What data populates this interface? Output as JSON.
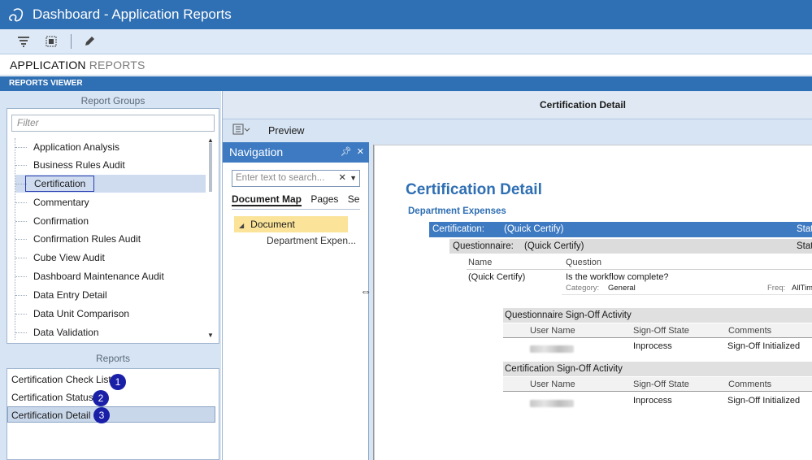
{
  "window": {
    "title": "Dashboard - Application Reports"
  },
  "icons": {
    "logo": "app-logo-icon",
    "filter": "filter-icon",
    "select": "select-icon",
    "edit": "pencil-icon"
  },
  "header": {
    "part1": "APPLICATION",
    "part2": "REPORTS"
  },
  "viewer": {
    "label": "REPORTS VIEWER"
  },
  "report_groups": {
    "heading": "Report Groups",
    "filter_placeholder": "Filter",
    "items": [
      "Application Analysis",
      "Business Rules Audit",
      "Certification",
      "Commentary",
      "Confirmation",
      "Confirmation Rules Audit",
      "Cube View Audit",
      "Dashboard Maintenance Audit",
      "Data Entry Detail",
      "Data Unit Comparison",
      "Data Validation"
    ],
    "selected": "Certification"
  },
  "reports": {
    "heading": "Reports",
    "items": [
      {
        "label": "Certification Check List",
        "badge": "1"
      },
      {
        "label": "Certification Status",
        "badge": "2"
      },
      {
        "label": "Certification Detail",
        "badge": "3"
      }
    ]
  },
  "right": {
    "title": "Certification Detail",
    "preview_label": "Preview"
  },
  "navigation": {
    "heading": "Navigation",
    "search_placeholder": "Enter text to search...",
    "tabs": [
      "Document Map",
      "Pages",
      "Se"
    ],
    "root": "Document",
    "child": "Department Expen..."
  },
  "doc": {
    "title": "Certification Detail",
    "dept": "Department Expenses",
    "cert_label": "Certification:",
    "cert_value": "(Quick Certify)",
    "stat1": "Stat",
    "q_label": "Questionnaire:",
    "q_value": "(Quick Certify)",
    "stat2": "Stat",
    "col_name": "Name",
    "col_question": "Question",
    "row_name": "(Quick Certify)",
    "row_question": "Is the workflow complete?",
    "category_label": "Category:",
    "category_value": "General",
    "freq_label": "Freq:",
    "freq_value": "AllTim",
    "q_signoff": "Questionnaire Sign-Off Activity",
    "cert_signoff": "Certification Sign-Off Activity",
    "col_user": "User Name",
    "col_state": "Sign-Off State",
    "col_comments": "Comments",
    "state1": "Inprocess",
    "comment1": "Sign-Off Initialized",
    "state2": "Inprocess",
    "comment2": "Sign-Off Initialized"
  }
}
